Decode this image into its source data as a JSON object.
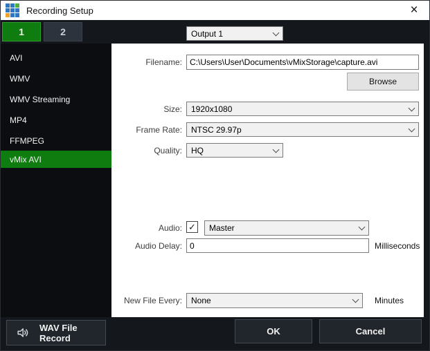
{
  "window": {
    "title": "Recording Setup"
  },
  "icons": {
    "close": "×",
    "check": "✓"
  },
  "output_tabs": {
    "tab1_label": "1",
    "tab2_label": "2"
  },
  "output_select": {
    "value": "Output 1"
  },
  "sidebar": {
    "items": [
      {
        "label": "AVI",
        "selected": false
      },
      {
        "label": "WMV",
        "selected": false
      },
      {
        "label": "WMV Streaming",
        "selected": false
      },
      {
        "label": "MP4",
        "selected": false
      },
      {
        "label": "FFMPEG",
        "selected": false
      },
      {
        "label": "vMix AVI",
        "selected": true
      }
    ]
  },
  "form": {
    "filename": {
      "label": "Filename:",
      "value": "C:\\Users\\User\\Documents\\vMixStorage\\capture.avi"
    },
    "browse_label": "Browse",
    "size": {
      "label": "Size:",
      "value": "1920x1080"
    },
    "frame_rate": {
      "label": "Frame Rate:",
      "value": "NTSC 29.97p"
    },
    "quality": {
      "label": "Quality:",
      "value": "HQ"
    },
    "audio": {
      "label": "Audio:",
      "checked": true,
      "value": "Master"
    },
    "audio_delay": {
      "label": "Audio Delay:",
      "value": "0",
      "unit": "Milliseconds"
    },
    "new_file_every": {
      "label": "New File Every:",
      "value": "None",
      "unit": "Minutes"
    }
  },
  "footer": {
    "wav_button_label": "WAV File Record",
    "ok_label": "OK",
    "cancel_label": "Cancel"
  },
  "colors": {
    "accent_green": "#0e7c0e",
    "accent_green_border": "#2f9e2f",
    "chrome_dark": "#14171b",
    "sidebar_dark": "#0b0d10",
    "panel_white": "#ffffff",
    "brand_blue": "#2f77c2",
    "brand_green": "#4caf3f",
    "brand_orange": "#f0a22e"
  }
}
